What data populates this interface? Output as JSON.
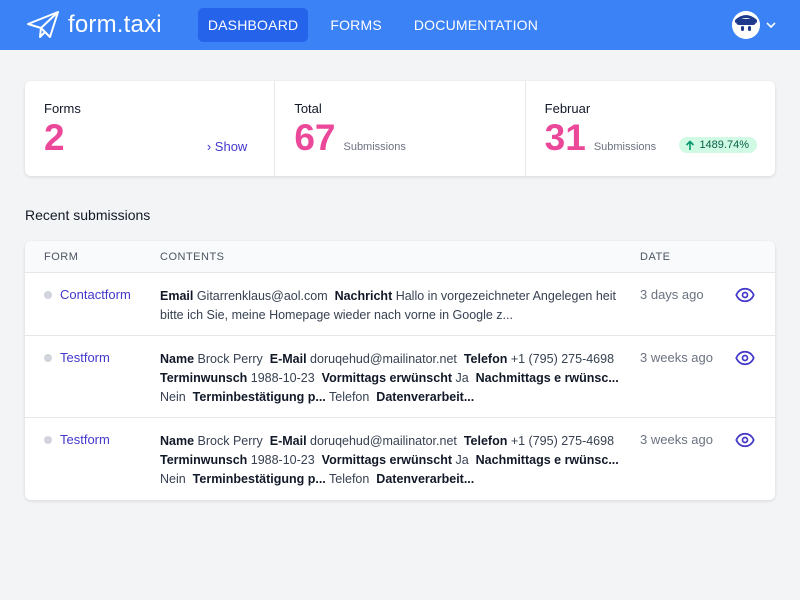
{
  "brand": {
    "name": "form.taxi",
    "logo_icon": "paper-plane-icon"
  },
  "nav": [
    {
      "label": "DASHBOARD",
      "active": true
    },
    {
      "label": "FORMS",
      "active": false
    },
    {
      "label": "DOCUMENTATION",
      "active": false
    }
  ],
  "stats": {
    "forms": {
      "label": "Forms",
      "value": "2",
      "link": "› Show"
    },
    "total": {
      "label": "Total",
      "value": "67",
      "sub": "Submissions"
    },
    "month": {
      "label": "Februar",
      "value": "31",
      "sub": "Submissions",
      "badge": "1489.74%"
    }
  },
  "recent": {
    "title": "Recent submissions",
    "columns": {
      "form": "FORM",
      "contents": "CONTENTS",
      "date": "DATE"
    },
    "rows": [
      {
        "form": "Contactform",
        "date": "3 days ago",
        "fields": [
          {
            "key": "Email",
            "value": "Gitarrenklaus@aol.com"
          },
          {
            "key": "Nachricht",
            "value": "Hallo in vorgezeichneter Angelegen heit bitte ich Sie, meine Homepage wieder nach vorne in Google z..."
          }
        ]
      },
      {
        "form": "Testform",
        "date": "3 weeks ago",
        "fields": [
          {
            "key": "Name",
            "value": "Brock Perry"
          },
          {
            "key": "E-Mail",
            "value": "doruqehud@mailinator.net"
          },
          {
            "key": "Telefon",
            "value": "+1 (795) 275-4698"
          },
          {
            "key": "Terminwunsch",
            "value": "1988-10-23"
          },
          {
            "key": "Vormittags erwünscht",
            "value": "Ja"
          },
          {
            "key": "Nachmittags e rwünsc...",
            "value": "Nein"
          },
          {
            "key": "Terminbestätigung p...",
            "value": "Telefon"
          },
          {
            "key": "Datenverarbeit...",
            "value": ""
          }
        ]
      },
      {
        "form": "Testform",
        "date": "3 weeks ago",
        "fields": [
          {
            "key": "Name",
            "value": "Brock Perry"
          },
          {
            "key": "E-Mail",
            "value": "doruqehud@mailinator.net"
          },
          {
            "key": "Telefon",
            "value": "+1 (795) 275-4698"
          },
          {
            "key": "Terminwunsch",
            "value": "1988-10-23"
          },
          {
            "key": "Vormittags erwünscht",
            "value": "Ja"
          },
          {
            "key": "Nachmittags e rwünsc...",
            "value": "Nein"
          },
          {
            "key": "Terminbestätigung p...",
            "value": "Telefon"
          },
          {
            "key": "Datenverarbeit...",
            "value": ""
          }
        ]
      }
    ]
  },
  "colors": {
    "topbar": "#3b82f6",
    "nav_active": "#2563eb",
    "stat_value": "#ec4899",
    "link": "#4338ca",
    "badge_bg": "#d1fae5"
  },
  "icons": {
    "view": "eye-icon",
    "account": "avatar-icon",
    "dropdown": "chevron-down-icon",
    "trend": "arrow-up-icon"
  }
}
